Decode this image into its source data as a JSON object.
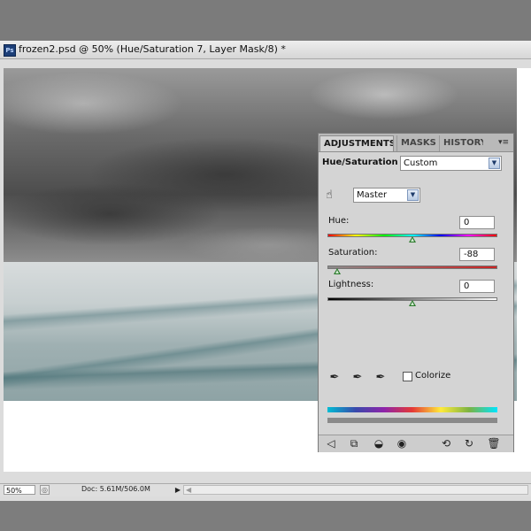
{
  "document": {
    "title": "frozen2.psd @ 50% (Hue/Saturation 7, Layer Mask/8) *",
    "app_icon_text": "Ps"
  },
  "statusbar": {
    "zoom": "50%",
    "doc_info": "Doc: 5.61M/506.0M"
  },
  "panel": {
    "tabs": [
      {
        "label": "ADJUSTMENTS",
        "active": true
      },
      {
        "label": "MASKS",
        "active": false
      },
      {
        "label": "HISTORY",
        "active": false
      }
    ],
    "title": "Hue/Saturation",
    "preset": "Custom",
    "channel": "Master",
    "hue": {
      "label": "Hue:",
      "value": "0"
    },
    "saturation": {
      "label": "Saturation:",
      "value": "-88"
    },
    "lightness": {
      "label": "Lightness:",
      "value": "0"
    },
    "colorize": {
      "label": "Colorize",
      "checked": false
    }
  },
  "icons": {
    "hand_tool": "targeted-adjustment-hand-icon",
    "eyedroppers": [
      "eyedropper-icon",
      "eyedropper-plus-icon",
      "eyedropper-minus-icon"
    ],
    "footer": [
      "back-arrow-icon",
      "expanded-view-icon",
      "clip-to-layer-icon",
      "visibility-eye-icon",
      "view-previous-icon",
      "reset-icon",
      "trash-icon"
    ]
  }
}
